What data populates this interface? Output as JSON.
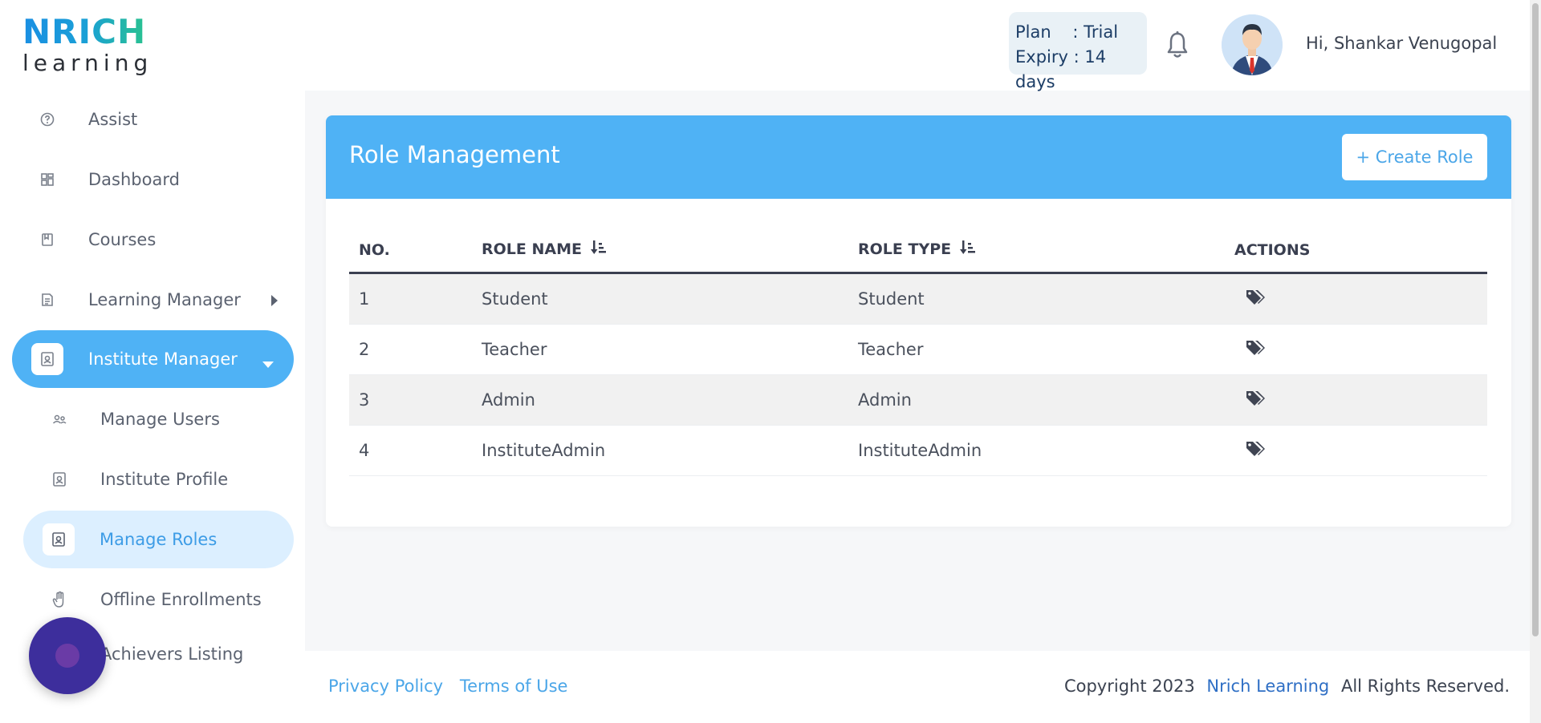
{
  "brand": {
    "logo_top": "NRICH",
    "logo_bottom": "learning"
  },
  "header": {
    "plan_line": "Plan    : Trial",
    "expiry_line": "Expiry : 14 days",
    "greeting": "Hi, Shankar Venugopal"
  },
  "sidebar": {
    "items": [
      {
        "label": "Assist",
        "icon": "help-circle-icon"
      },
      {
        "label": "Dashboard",
        "icon": "dashboard-icon"
      },
      {
        "label": "Courses",
        "icon": "book-icon"
      },
      {
        "label": "Learning Manager",
        "icon": "document-icon"
      },
      {
        "label": "Institute Manager",
        "icon": "id-card-icon"
      }
    ],
    "sub_items": [
      {
        "label": "Manage Users",
        "icon": "users-icon"
      },
      {
        "label": "Institute Profile",
        "icon": "id-card-icon"
      },
      {
        "label": "Manage Roles",
        "icon": "id-card-icon"
      },
      {
        "label": "Offline Enrollments",
        "icon": "hand-icon"
      },
      {
        "label": "Achievers Listing",
        "icon": "trophy-icon"
      }
    ]
  },
  "page": {
    "title": "Role Management",
    "create_label": "+ Create Role"
  },
  "table": {
    "headers": [
      "NO.",
      "ROLE NAME",
      "ROLE TYPE",
      "ACTIONS"
    ],
    "rows": [
      {
        "no": "1",
        "name": "Student",
        "type": "Student"
      },
      {
        "no": "2",
        "name": "Teacher",
        "type": "Teacher"
      },
      {
        "no": "3",
        "name": "Admin",
        "type": "Admin"
      },
      {
        "no": "4",
        "name": "InstituteAdmin",
        "type": "InstituteAdmin"
      }
    ]
  },
  "footer": {
    "privacy": "Privacy Policy",
    "terms": "Terms of Use",
    "copyright_prefix": "Copyright 2023",
    "brand": "Nrich Learning",
    "copyright_suffix": "All Rights Reserved."
  },
  "colors": {
    "accent": "#4fb2f5",
    "active_sub_bg": "#dcefff",
    "fab": "#3d2e9c"
  }
}
